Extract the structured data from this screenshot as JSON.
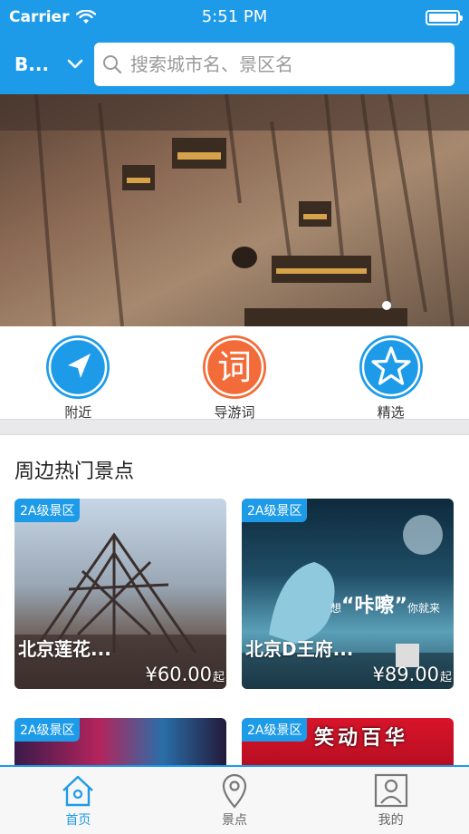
{
  "status": {
    "carrier": "Carrier",
    "time": "5:51 PM"
  },
  "header": {
    "city": "B...",
    "search_placeholder": "搜索城市名、景区名"
  },
  "banner": {
    "dot_count": 1
  },
  "quick_menu": [
    {
      "label": "附近",
      "icon": "navigation-arrow-icon"
    },
    {
      "label": "导游词",
      "icon": "word-icon",
      "glyph": "词"
    },
    {
      "label": "精选",
      "icon": "star-icon"
    }
  ],
  "hot": {
    "title": "周边热门景点",
    "cards": [
      {
        "badge": "2A级景区",
        "name": "北京莲花...",
        "price": "¥60.00",
        "unit": "起"
      },
      {
        "badge": "2A级景区",
        "name": "北京D王府...",
        "price": "¥89.00",
        "unit": "起"
      },
      {
        "badge": "2A级景区"
      },
      {
        "badge": "2A级景区",
        "banner_text": "笑动百华"
      }
    ],
    "card2_slogan": {
      "pre": "想",
      "mid": "“咔嚓”",
      "post": "你就来"
    }
  },
  "tabbar": [
    {
      "label": "首页",
      "icon": "home-icon",
      "active": true
    },
    {
      "label": "景点",
      "icon": "location-pin-icon",
      "active": false
    },
    {
      "label": "我的",
      "icon": "profile-icon",
      "active": false
    }
  ],
  "colors": {
    "accent": "#1e9be8",
    "orange": "#f26b38"
  }
}
